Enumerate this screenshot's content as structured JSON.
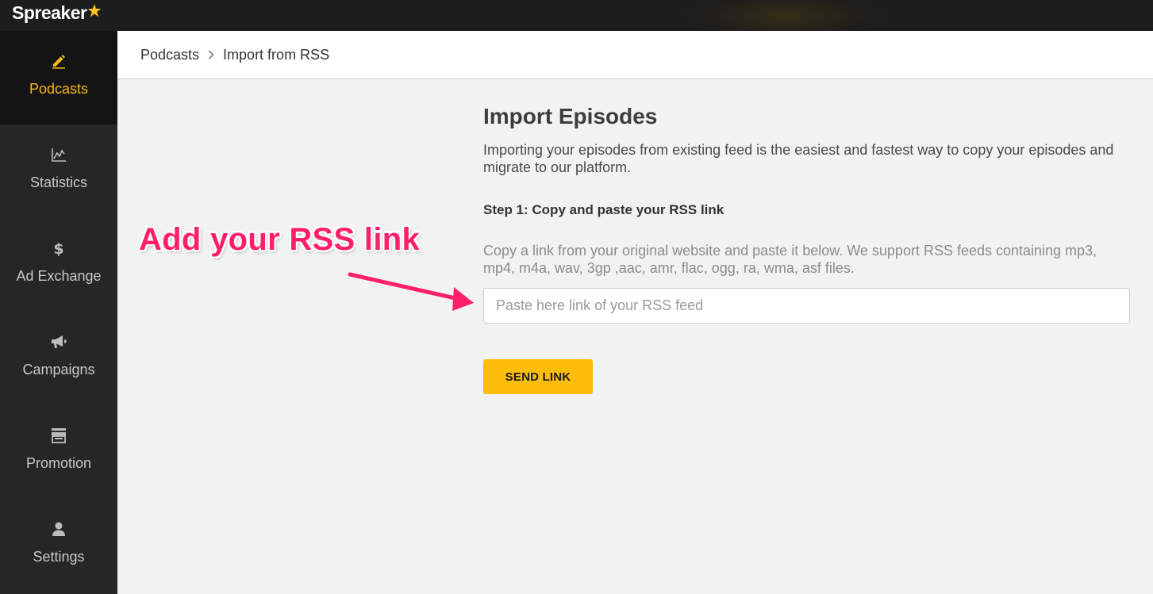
{
  "app": {
    "logo_text": "Spreaker"
  },
  "sidebar": {
    "items": [
      {
        "label": "Podcasts",
        "icon": "pencil-icon",
        "active": true
      },
      {
        "label": "Statistics",
        "icon": "line-chart-icon",
        "active": false
      },
      {
        "label": "Ad Exchange",
        "icon": "dollar-icon",
        "active": false
      },
      {
        "label": "Campaigns",
        "icon": "megaphone-icon",
        "active": false
      },
      {
        "label": "Promotion",
        "icon": "storefront-icon",
        "active": false
      },
      {
        "label": "Settings",
        "icon": "user-icon",
        "active": false
      }
    ]
  },
  "breadcrumb": {
    "root": "Podcasts",
    "current": "Import from RSS"
  },
  "main": {
    "title": "Import Episodes",
    "intro": "Importing your episodes from existing feed is the easiest and fastest way to copy your episodes and migrate to our platform.",
    "step_label": "Step 1: Copy and paste your RSS link",
    "hint": "Copy a link from your original website and paste it below. We support RSS feeds containing mp3, mp4, m4a, wav, 3gp ,aac, amr, flac, ogg, ra, wma, asf files.",
    "rss_input": {
      "value": "",
      "placeholder": "Paste here link of your RSS feed"
    },
    "send_button": "SEND LINK"
  },
  "annotation": {
    "text": "Add your RSS link"
  },
  "colors": {
    "accent": "#f8b914",
    "button": "#fbbd08",
    "annotation": "#ff1f6a",
    "sidebar": "#262626"
  }
}
